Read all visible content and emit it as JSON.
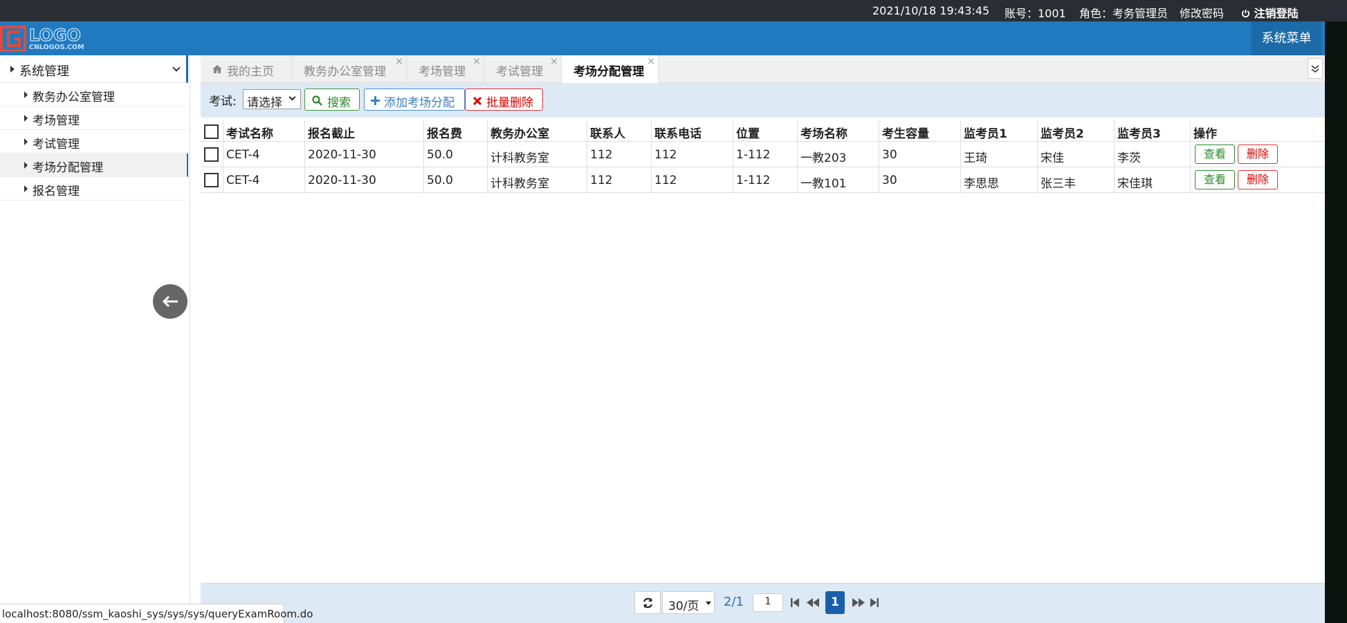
{
  "topbar": {
    "datetime": "2021/10/18 19:43:45",
    "account": "账号：1001",
    "role": "角色：考务管理员",
    "change_password": "修改密码",
    "logout": "注销登陆"
  },
  "header": {
    "logo_text": "LOGO",
    "logo_sub": "CNLOGOS.COM",
    "system_menu": "系统菜单"
  },
  "sidebar": {
    "group": "系统管理",
    "items": [
      {
        "label": "教务办公室管理"
      },
      {
        "label": "考场管理"
      },
      {
        "label": "考试管理"
      },
      {
        "label": "考场分配管理"
      },
      {
        "label": "报名管理"
      }
    ]
  },
  "tabs": [
    {
      "label": "我的主页"
    },
    {
      "label": "教务办公室管理"
    },
    {
      "label": "考场管理"
    },
    {
      "label": "考试管理"
    },
    {
      "label": "考场分配管理"
    }
  ],
  "toolbar": {
    "exam_label": "考试:",
    "exam_select_value": "请选择",
    "search_label": "搜索",
    "add_label": "添加考场分配",
    "batch_delete_label": "批量删除"
  },
  "table": {
    "columns": [
      "考试名称",
      "报名截止",
      "报名费",
      "教务办公室",
      "联系人",
      "联系电话",
      "位置",
      "考场名称",
      "考生容量",
      "监考员1",
      "监考员2",
      "监考员3",
      "操作"
    ],
    "rows": [
      [
        "CET-4",
        "2020-11-30",
        "50.0",
        "计科教务室",
        "112",
        "112",
        "1-112",
        "一教203",
        "30",
        "王琦",
        "宋佳",
        "李茨"
      ],
      [
        "CET-4",
        "2020-11-30",
        "50.0",
        "计科教务室",
        "112",
        "112",
        "1-112",
        "一教101",
        "30",
        "李思思",
        "张三丰",
        "宋佳琪"
      ]
    ],
    "view_label": "查看",
    "delete_label": "删除"
  },
  "pager": {
    "page_size": "30/页",
    "page_info": "2/1",
    "page_input": "1",
    "current_page": "1"
  },
  "statusbar": {
    "url": "localhost:8080/ssm_kaoshi_sys/sys/sys/queryExamRoom.do"
  },
  "colors": {
    "header": "#2179bf",
    "topbar": "#2a2d33",
    "toolbar": "#dde9f4",
    "success": "#2a8a2a",
    "danger": "#d00000",
    "primary": "#1a5fa8"
  }
}
